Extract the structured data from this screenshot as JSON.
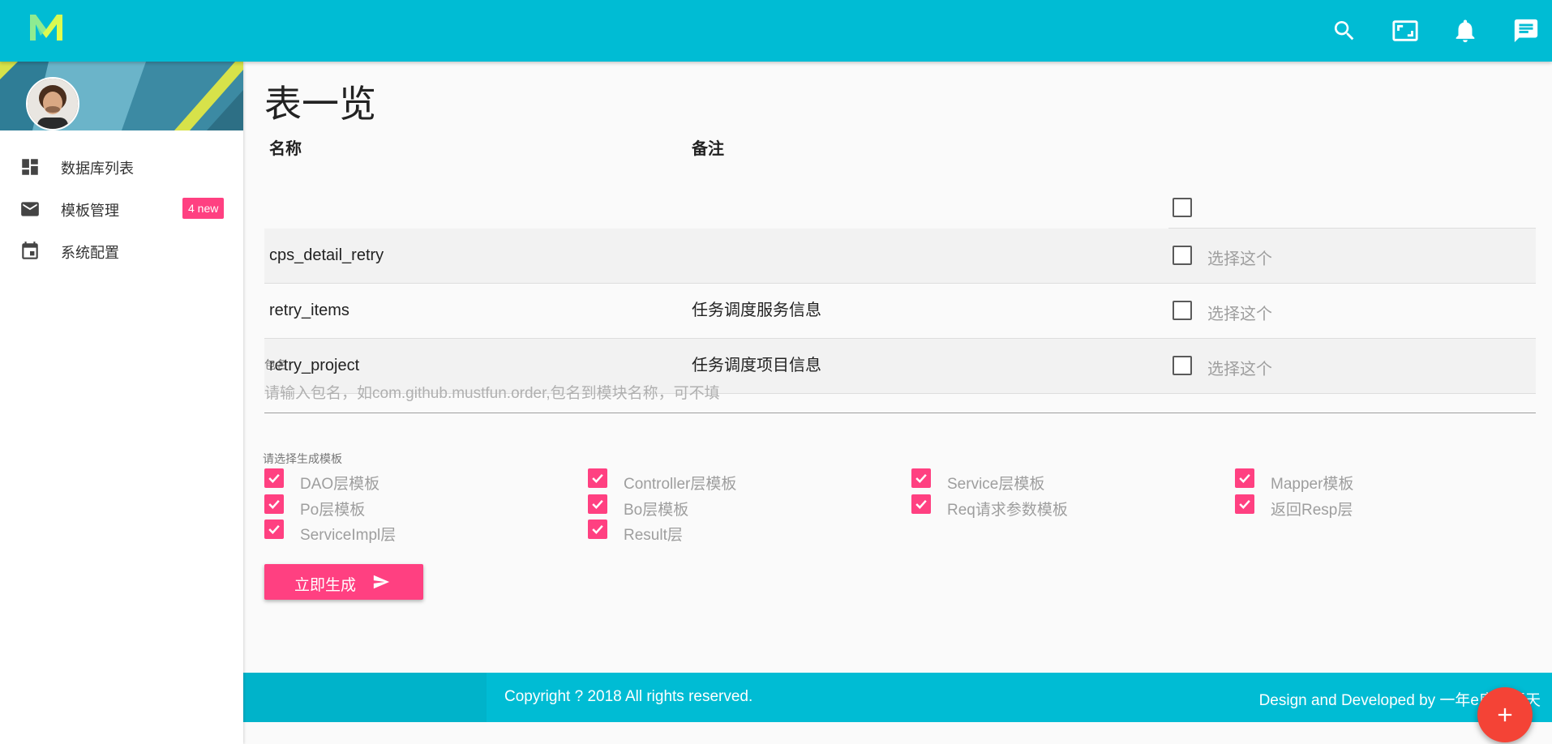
{
  "app": {
    "logo_text": "M",
    "accent": "#00bcd4",
    "pink": "#ff4081",
    "fab_color": "#f44336"
  },
  "header": {
    "icons": [
      "search-icon",
      "fullscreen-icon",
      "bell-icon",
      "message-icon"
    ]
  },
  "sidebar": {
    "items": [
      {
        "label": "数据库列表",
        "icon": "dashboard-icon"
      },
      {
        "label": "模板管理",
        "icon": "mail-icon",
        "badge": "4 new"
      },
      {
        "label": "系统配置",
        "icon": "calendar-icon"
      }
    ]
  },
  "main": {
    "title": "表一览",
    "table": {
      "headers": [
        "名称",
        "备注"
      ],
      "select_label": "选择这个",
      "rows": [
        {
          "name": "cps_detail_retry",
          "remark": ""
        },
        {
          "name": "retry_items",
          "remark": "任务调度服务信息"
        },
        {
          "name": "retry_project",
          "remark": "任务调度项目信息"
        }
      ]
    },
    "package": {
      "label": "包名",
      "placeholder": "请输入包名，如com.github.mustfun.order,包名到模块名称，可不填",
      "value": ""
    },
    "templates": {
      "label": "请选择生成模板",
      "items": [
        {
          "label": "DAO层模板",
          "checked": true
        },
        {
          "label": "Controller层模板",
          "checked": true
        },
        {
          "label": "Service层模板",
          "checked": true
        },
        {
          "label": "Mapper模板",
          "checked": true
        },
        {
          "label": "Po层模板",
          "checked": true
        },
        {
          "label": "Bo层模板",
          "checked": true
        },
        {
          "label": "Req请求参数模板",
          "checked": true
        },
        {
          "label": "返回Resp层",
          "checked": true
        },
        {
          "label": "ServiceImpl层",
          "checked": true
        },
        {
          "label": "Result层",
          "checked": true
        }
      ]
    },
    "generate_button": "立即生成"
  },
  "footer": {
    "copyright": "Copyright ? 2018 All rights reserved.",
    "credit": "Design and Developed by 一年e度的夏天"
  },
  "fab": {
    "label": "+"
  }
}
